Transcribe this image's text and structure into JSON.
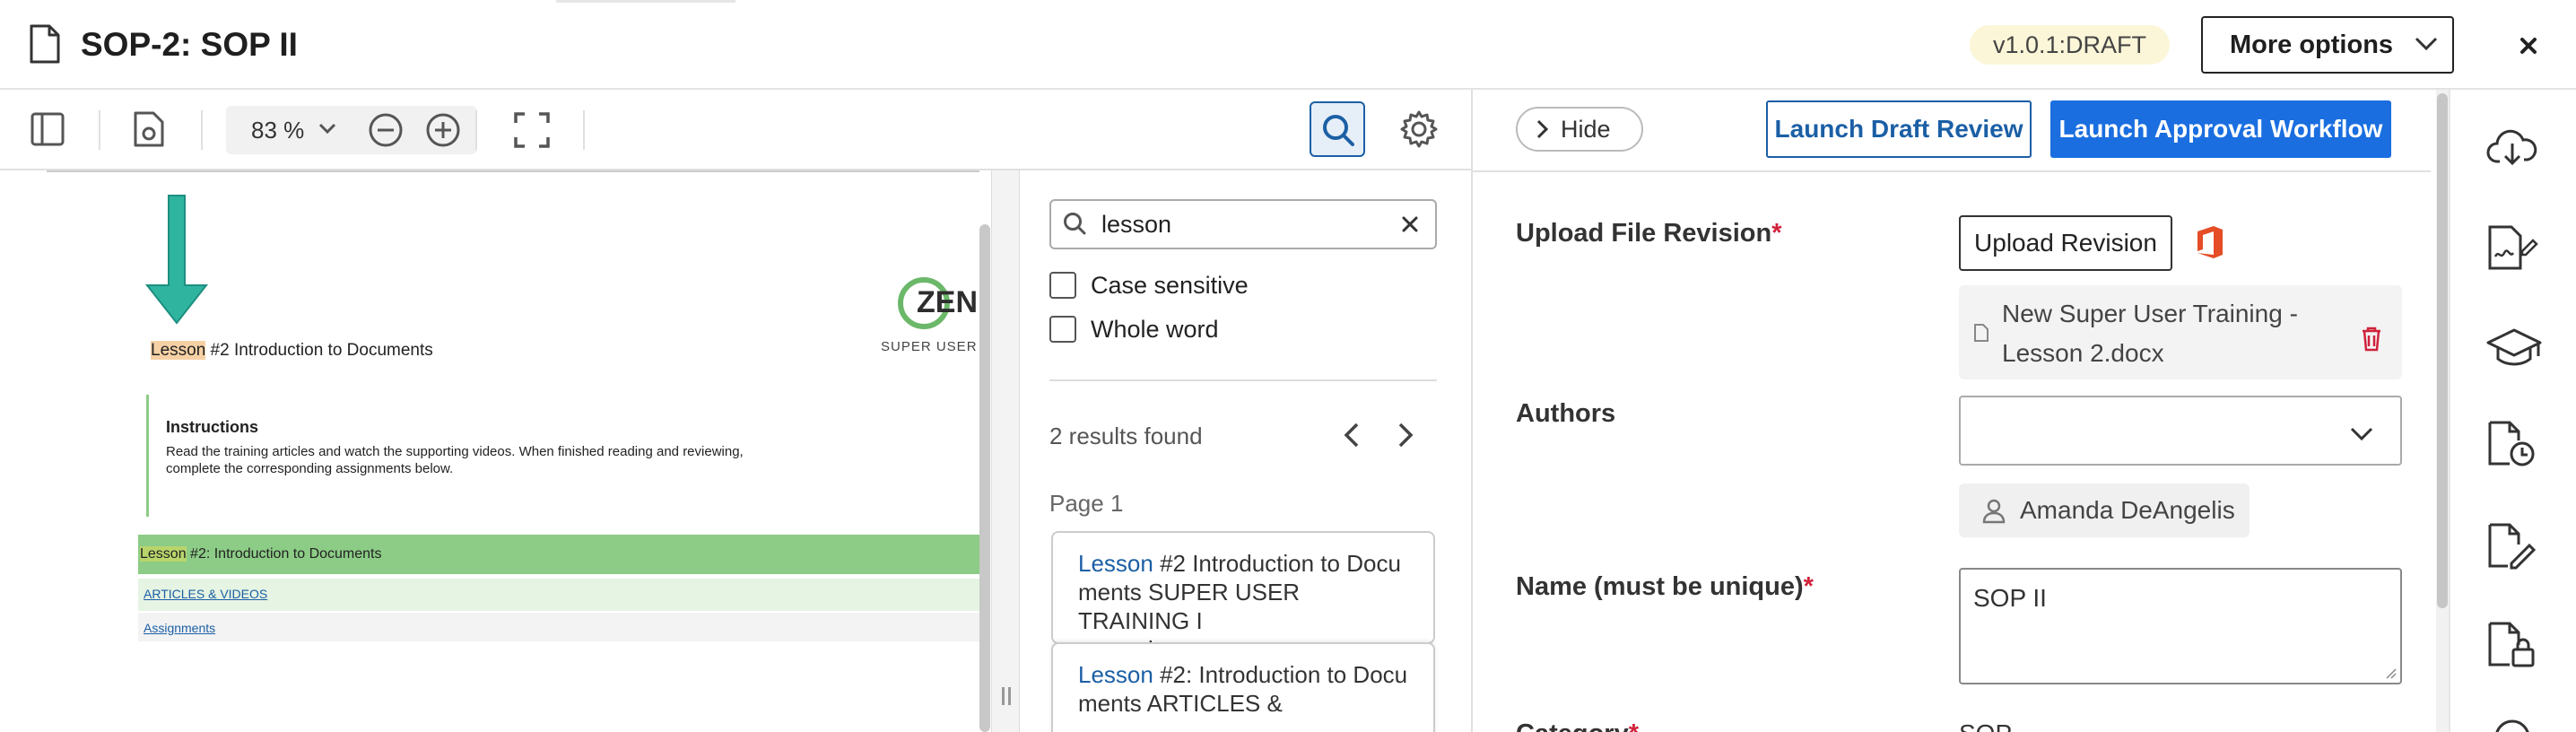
{
  "header": {
    "title": "SOP-2: SOP II",
    "version_badge": "v1.0.1:DRAFT",
    "more_options_label": "More options"
  },
  "viewer_toolbar": {
    "zoom_value": "83 %"
  },
  "pdf_page": {
    "lesson_word": "Lesson",
    "title_rest": " #2 Introduction to Documents",
    "logo_text": "ZEN",
    "logo_subtext": "SUPER USER TR",
    "instructions_heading": "Instructions",
    "instructions_line1": "Read the training articles and watch the supporting videos. When finished reading and reviewing,",
    "instructions_line2": "complete the corresponding assignments below.",
    "table_header_word": "Lesson",
    "table_header_rest": " #2: Introduction to Documents",
    "table_link1": "ARTICLES & VIDEOS",
    "table_link2": "Assignments"
  },
  "search_panel": {
    "query": "lesson",
    "case_sensitive_label": "Case sensitive",
    "whole_word_label": "Whole word",
    "results_count": "2 results found",
    "page_label": "Page 1",
    "results": [
      {
        "hit": "Lesson",
        "line1_rest": " #2 Introduction to Docu",
        "line2": "ments SUPER USER TRAINING I",
        "line3": "nstructions"
      },
      {
        "hit": "Lesson",
        "line1_rest": " #2: Introduction to Docu",
        "line2": "ments ARTICLES &"
      }
    ]
  },
  "right_panel": {
    "hide_label": "Hide",
    "draft_review_label": "Launch Draft Review",
    "approval_label": "Launch Approval Workflow",
    "upload_label": "Upload File Revision",
    "required_mark": "*",
    "upload_button": "Upload Revision",
    "file_name_line1": "New Super User Training -",
    "file_name_line2": "Lesson 2.docx",
    "authors_label": "Authors",
    "author_chip": "Amanda DeAngelis",
    "name_label": "Name (must be unique)",
    "name_value": "SOP II",
    "category_label": "Category",
    "category_value": "SOP"
  },
  "icons": {
    "header": [
      "document-icon",
      "chevron-down-icon",
      "close-icon"
    ],
    "toolbar": [
      "sidebar-toggle-icon",
      "document-settings-icon",
      "zoom-out-icon",
      "zoom-in-icon",
      "fullscreen-icon",
      "search-icon",
      "gear-icon"
    ],
    "rail": [
      "cloud-download-icon",
      "signature-document-icon",
      "graduation-cap-icon",
      "document-history-icon",
      "document-edit-icon",
      "document-lock-icon"
    ]
  },
  "colors": {
    "accent": "#1a6ee0",
    "accent_dark": "#1b5fa5",
    "required": "#d0213b",
    "badge_bg": "#fbf6d8",
    "delete_red": "#d0213b",
    "office_orange": "#e44d26",
    "pdf_green": "#8ccc86"
  }
}
